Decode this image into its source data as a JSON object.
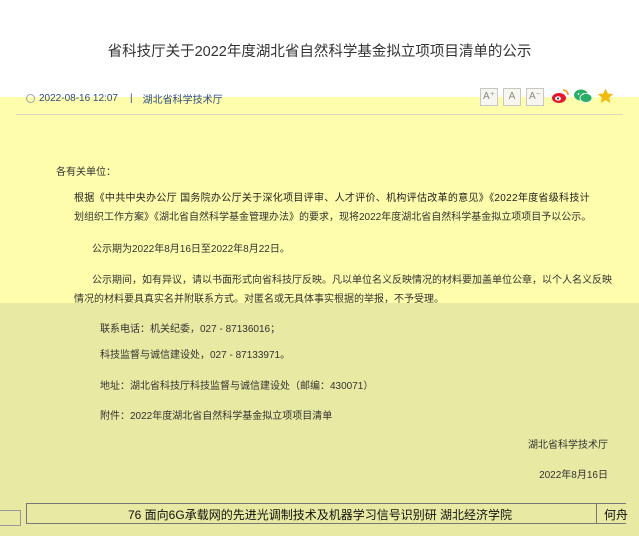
{
  "article": {
    "title": "省科技厅关于2022年度湖北省自然科学基金拟立项项目清单的公示",
    "date": "2022-08-16 12:07",
    "separator": "|",
    "source": "湖北省科学技术厅"
  },
  "toolbar": {
    "font_large": "A⁺",
    "font_medium": "A",
    "font_small": "A⁻",
    "share_icons": [
      "weibo-icon",
      "wechat-icon",
      "favorite-star-icon"
    ]
  },
  "body": {
    "salutation": "各有关单位：",
    "para1_line1": "根据《中共中央办公厅 国务院办公厅关于深化项目评审、人才评价、机构评估改革的意见》《2022年度省级科技计",
    "para1_line2": "划组织工作方案》《湖北省自然科学基金管理办法》的要求，现将2022年度湖北省自然科学基金拟立项项目予以公示。",
    "para2": "公示期为2022年8月16日至2022年8月22日。",
    "para3_line1": "公示期间，如有异议，请以书面形式向省科技厅反映。凡以单位名义反映情况的材料要加盖单位公章，以个人名义反映",
    "para3_line2": "情况的材料要具真实名并附联系方式。对匿名或无具体事实根据的举报，不予受理。",
    "contact_phone": "联系电话：机关纪委，027 - 87136016；",
    "contact_dept": "科技监督与诚信建设处，027 - 87133971。",
    "address": "地址：湖北省科技厅科技监督与诚信建设处（邮编：430071）",
    "attachment": "附件：2022年度湖北省自然科学基金拟立项项目清单",
    "signature_org": "湖北省科学技术厅",
    "signature_date": "2022年8月16日"
  },
  "footer": {
    "row_text": "76 面向6G承载网的先进光调制技术及机器学习信号识别研 湖北经济学院",
    "row_name": "何舟"
  },
  "colors": {
    "highlight_top": "#fdfdab",
    "highlight_bottom": "#e8e9a2",
    "meta_text": "#2e4b8a",
    "weibo": "#e6162d",
    "wechat": "#2aae67",
    "star": "#f2b90f"
  }
}
